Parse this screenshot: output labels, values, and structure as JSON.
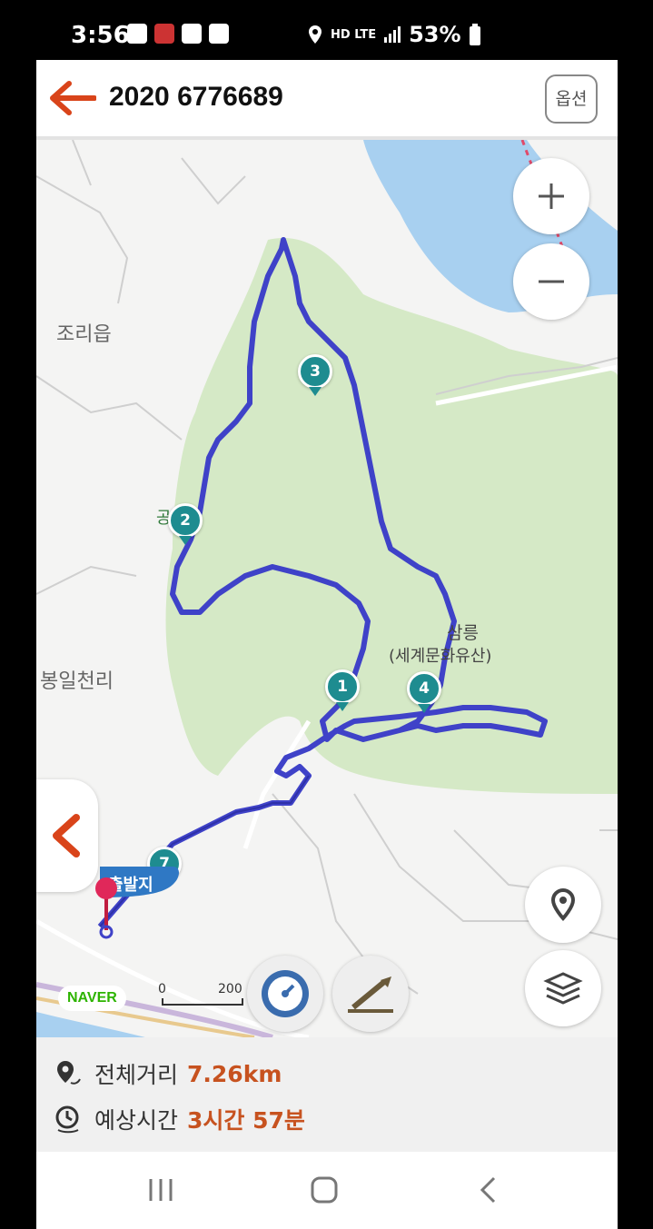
{
  "status_bar": {
    "time": "3:56",
    "network": "HD LTE",
    "battery": "53%"
  },
  "header": {
    "title": "2020 6776689",
    "options_label": "옵션"
  },
  "map": {
    "place_labels": {
      "jori": "조리읍",
      "bongil": "봉일천리",
      "gongsun": "공릉산",
      "samneung": "삼릉",
      "heritage": "(세계문화유산)"
    },
    "markers": [
      "1",
      "2",
      "3",
      "4",
      "7"
    ],
    "start_label": "출발지",
    "scale": {
      "zero": "0",
      "distance": "200"
    },
    "provider": "NAVER",
    "colors": {
      "route": "#3f42c8",
      "forest": "#d5e9c6",
      "water": "#a8d0f0",
      "marker": "#1e8c90",
      "accent": "#c7521f"
    }
  },
  "summary": {
    "distance_label": "전체거리",
    "distance_value": "7.26km",
    "time_label": "예상시간",
    "time_value": "3시간 57분"
  }
}
